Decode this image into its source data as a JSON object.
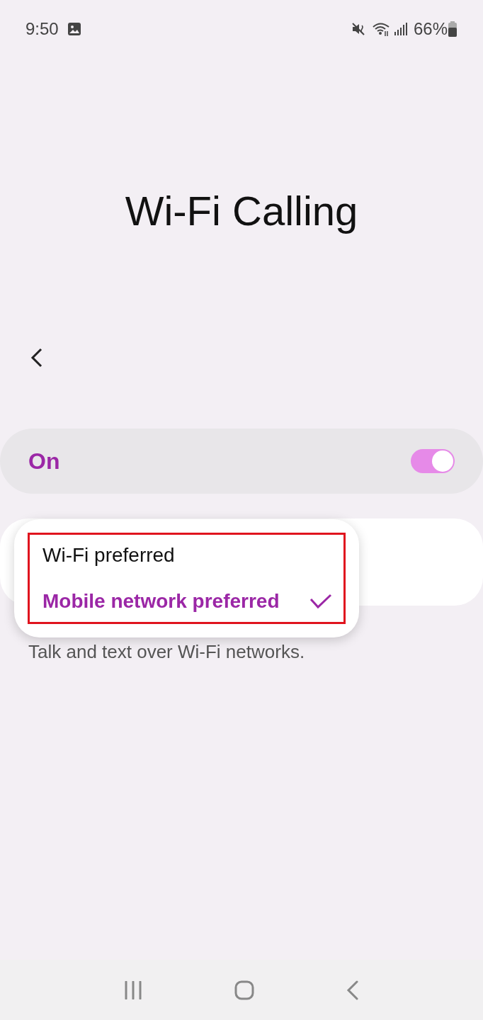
{
  "status_bar": {
    "time": "9:50",
    "battery": "66%"
  },
  "title": "Wi-Fi Calling",
  "master_switch": {
    "label": "On",
    "on": true
  },
  "description": "Talk and text over Wi-Fi networks.",
  "popup": {
    "highlighted": true,
    "options": [
      {
        "label": "Wi-Fi preferred",
        "selected": false
      },
      {
        "label": "Mobile network preferred",
        "selected": true
      }
    ]
  }
}
